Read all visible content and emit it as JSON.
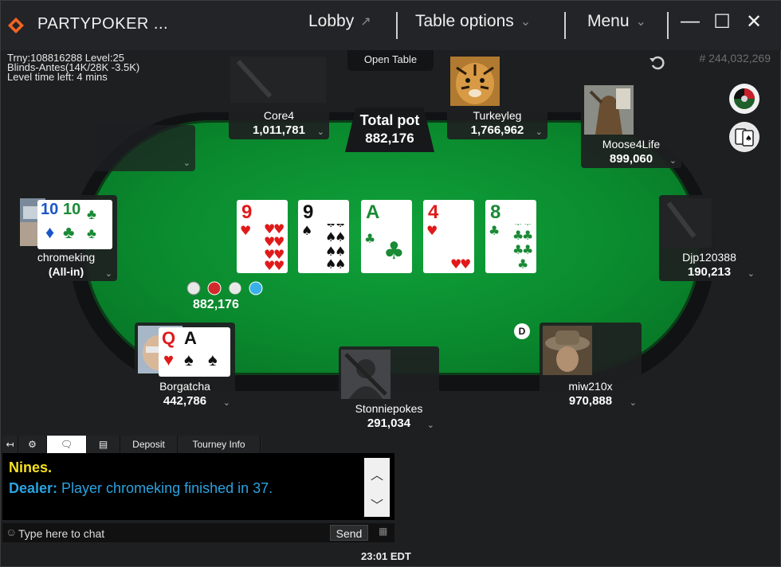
{
  "window": {
    "title": "PARTYPOKER ...",
    "lobby_label": "Lobby",
    "table_options_label": "Table options",
    "menu_label": "Menu",
    "minimize_glyph": "—",
    "maximize_glyph": "☐",
    "close_glyph": "✕"
  },
  "tourney": {
    "line1": "Trny:108816288 Level:25",
    "line2": "Blinds-Antes(14K/28K -3.5K)",
    "line3": "Level time left: 4 mins"
  },
  "hand_id": "# 244,032,269",
  "open_table_label": "Open Table",
  "pot": {
    "label": "Total pot",
    "amount": "882,176",
    "chip_amount": "882,176"
  },
  "board": [
    {
      "rank": "9",
      "suit": "♥",
      "color": "red"
    },
    {
      "rank": "9",
      "suit": "♠",
      "color": "blk"
    },
    {
      "rank": "A",
      "suit": "♣",
      "color": "grn"
    },
    {
      "rank": "4",
      "suit": "♥",
      "color": "red"
    },
    {
      "rank": "8",
      "suit": "♣",
      "color": "grn"
    }
  ],
  "seats": {
    "core4": {
      "name": "Core4",
      "stack": "1,011,781"
    },
    "turkeyleg": {
      "name": "Turkeyleg",
      "stack": "1,766,962"
    },
    "moose": {
      "name": "Moose4Life",
      "stack": "899,060"
    },
    "djp": {
      "name": "Djp120388",
      "stack": "190,213"
    },
    "miw": {
      "name": "miw210x",
      "stack": "970,888"
    },
    "stonnie": {
      "name": "Stonniepokes",
      "stack": "291,034"
    },
    "borgatcha": {
      "name": "Borgatcha",
      "stack": "442,786",
      "cards": [
        {
          "rank": "Q",
          "suit": "♥"
        },
        {
          "rank": "A",
          "suit": "♠"
        }
      ]
    },
    "chromeking": {
      "name": "chromeking",
      "stack": "(All-in)",
      "cards": [
        {
          "rank": "10",
          "suit": "♦"
        },
        {
          "rank": "10",
          "suit": "♣"
        }
      ]
    }
  },
  "dealer_label": "D",
  "chat": {
    "tabs": [
      "Deposit",
      "Tourney Info"
    ],
    "line1": "Nines.",
    "line2_prefix": "Dealer:",
    "line2_text": " Player chromeking finished in 37.",
    "input_placeholder": "Type here to chat",
    "send_label": "Send"
  },
  "clock": "23:01 EDT",
  "colors": {
    "felt": "#0a8a2e",
    "accent": "#f26522",
    "chat_yellow": "#f5e020",
    "chat_blue": "#2aa3e0"
  }
}
